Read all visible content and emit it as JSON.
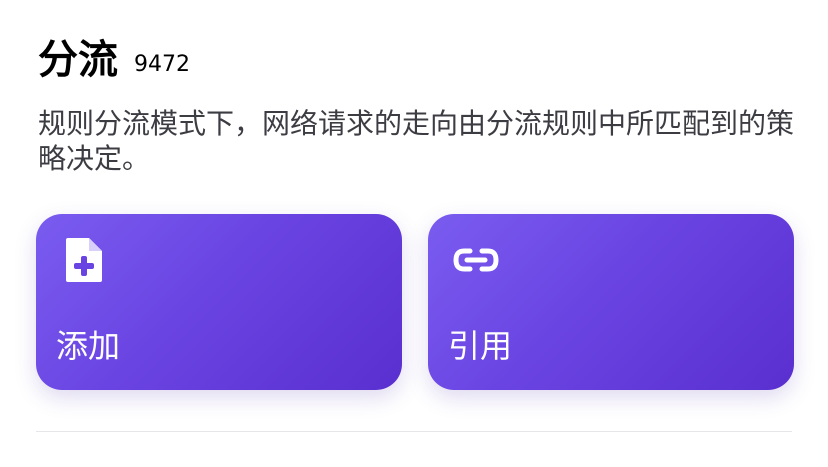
{
  "section": {
    "title": "分流",
    "count": "9472",
    "description": "规则分流模式下，网络请求的走向由分流规则中所匹配到的策略决定。"
  },
  "actions": [
    {
      "label": "添加",
      "icon": "add-file-icon"
    },
    {
      "label": "引用",
      "icon": "link-icon"
    }
  ],
  "colors": {
    "card_gradient_start": "#7a5cf0",
    "card_gradient_end": "#5a2fd0",
    "card_text": "#ffffff",
    "description_text": "#3c3c43"
  }
}
